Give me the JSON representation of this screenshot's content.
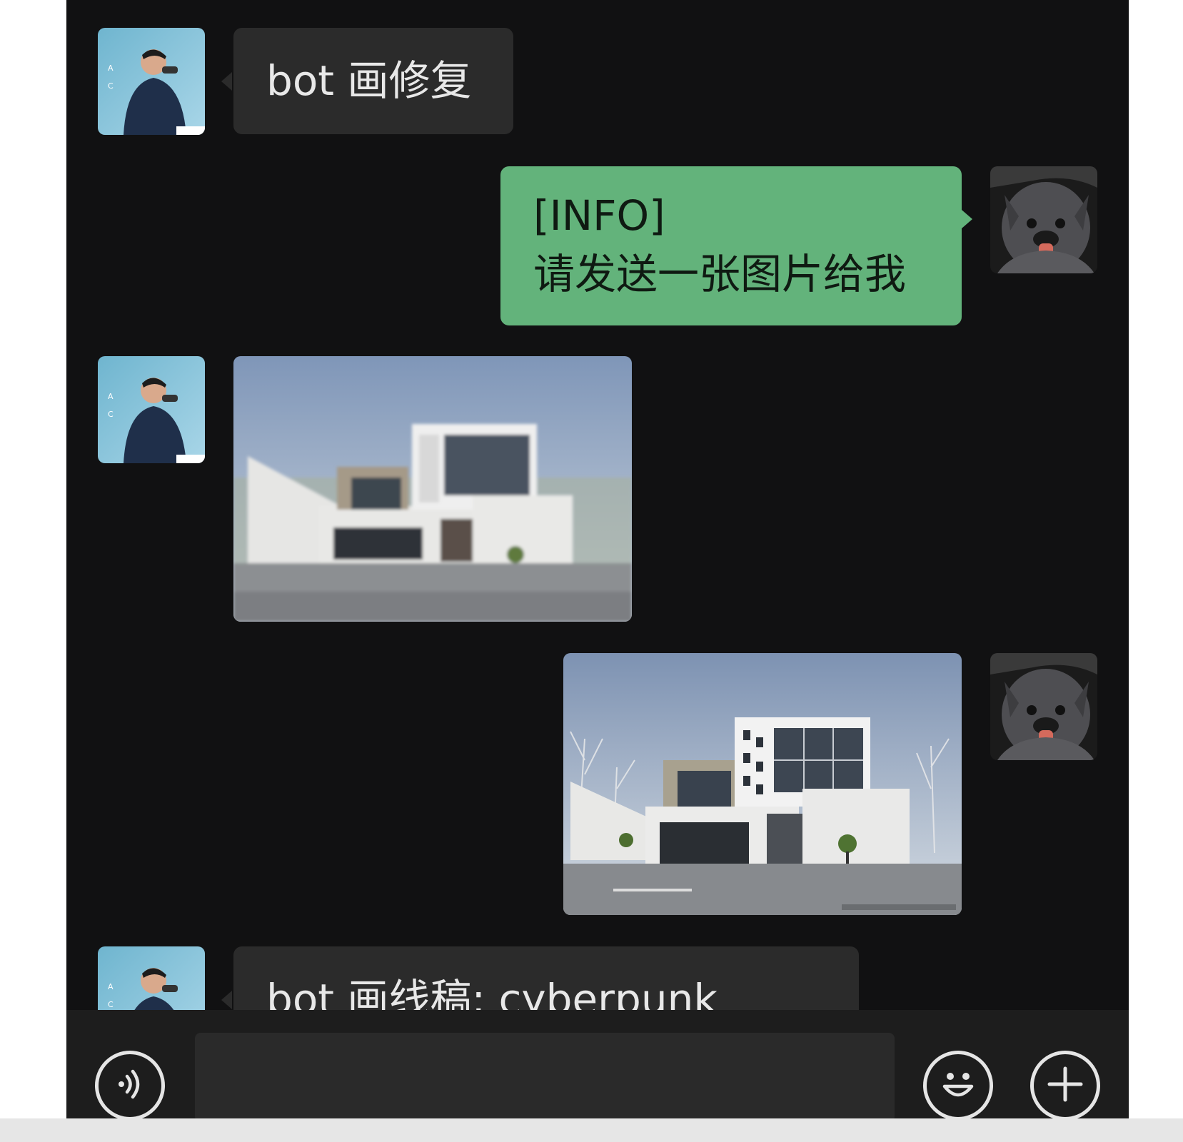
{
  "chat": {
    "messages": [
      {
        "side": "left",
        "type": "text",
        "text": "bot 画修复"
      },
      {
        "side": "right",
        "type": "text",
        "text": "[INFO]\n请发送一张图片给我"
      },
      {
        "side": "left",
        "type": "image",
        "description_icon": "building-photo-blurry"
      },
      {
        "side": "right",
        "type": "image",
        "description_icon": "building-photo-restored"
      },
      {
        "side": "left",
        "type": "text",
        "text": "bot 画线稿: cyberpunk"
      }
    ]
  },
  "input_bar": {
    "voice_icon": "voice-icon",
    "input_value": "",
    "input_placeholder": "",
    "emoji_icon": "emoji-icon",
    "add_icon": "plus-icon"
  },
  "colors": {
    "background": "#111112",
    "left_bubble": "#2b2b2b",
    "right_bubble": "#63b37b",
    "input_bar": "#1d1d1d"
  }
}
